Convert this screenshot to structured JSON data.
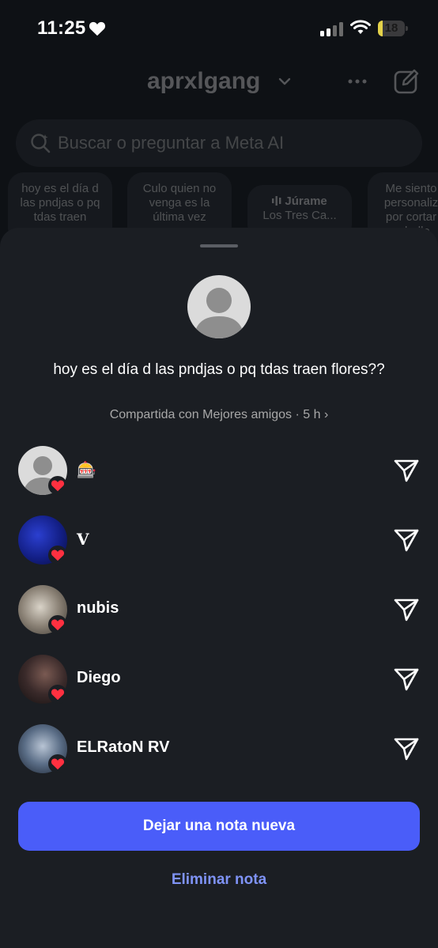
{
  "status_bar": {
    "time": "11:25",
    "battery": "18",
    "battery_level": 0.18
  },
  "header": {
    "title": "aprxlgang"
  },
  "search": {
    "placeholder": "Buscar o preguntar a Meta AI"
  },
  "notes_tray": [
    {
      "text": "hoy es el día d las pndjas o pq tdas traen"
    },
    {
      "text": "Culo quien no venga es la última vez"
    },
    {
      "title": "Júrame",
      "subtitle": "Los Tres Ca..."
    },
    {
      "text": "Me siento personaliz por cortar cabello"
    }
  ],
  "sheet": {
    "note_text": "hoy es el día d las pndjas o pq tdas traen flores??",
    "shared_info": "Compartida con Mejores amigos · 5 h ›",
    "reactions": [
      {
        "name": "🎰",
        "avatar_color": "#dbdbdb"
      },
      {
        "name": "V",
        "avatar_color": "#1a2a8a"
      },
      {
        "name": "nubis",
        "avatar_color": "#8a8175"
      },
      {
        "name": "Diego",
        "avatar_color": "#3a2a2a"
      },
      {
        "name": "ELRatoN RV",
        "avatar_color": "#6d7d90"
      }
    ],
    "primary_button": "Dejar una nota nueva",
    "delete_link": "Eliminar nota"
  },
  "colors": {
    "accent": "#4a5df9",
    "link": "#7f93f6",
    "heart": "#ff3040",
    "sheet_bg": "#1b1e23"
  }
}
